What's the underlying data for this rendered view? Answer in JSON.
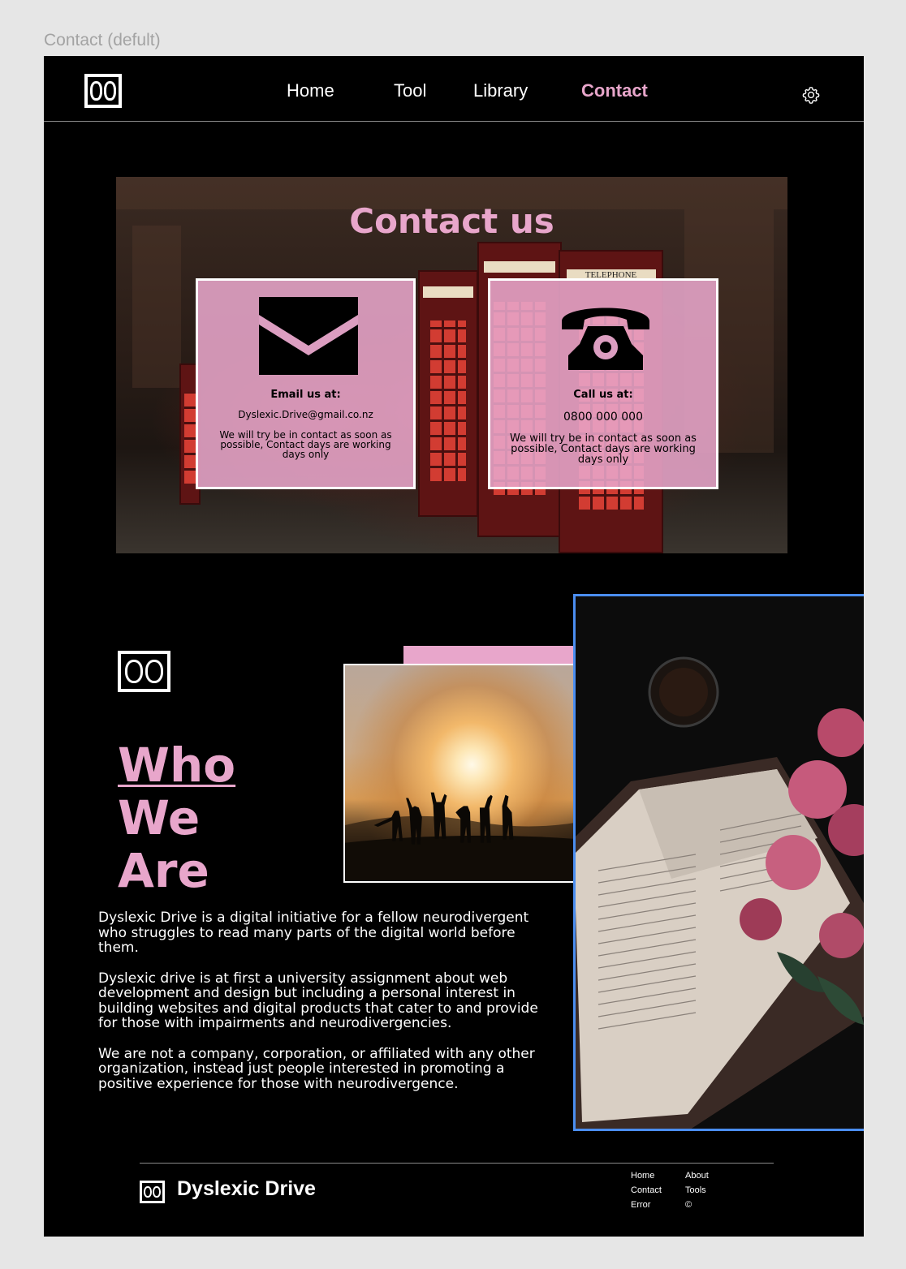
{
  "frame_label": "Contact (defult)",
  "nav": {
    "links": [
      "Home",
      "Tool",
      "Library",
      "Contact"
    ],
    "active": "Contact"
  },
  "hero": {
    "title": "Contact us",
    "email_card": {
      "heading": "Email us at:",
      "value": "Dyslexic.Drive@gmail.co.nz",
      "note": "We will try be in contact as soon as possible, Contact days are working days only",
      "icon": "envelope-icon"
    },
    "call_card": {
      "heading": "Call us at:",
      "value": "0800 000 000",
      "note": "We will try be in contact as soon as possible, Contact days are working days only",
      "icon": "telephone-icon"
    },
    "booth_sign": "TELEPHONE"
  },
  "about": {
    "title": [
      "Who",
      "We",
      "Are"
    ],
    "paragraphs": [
      "Dyslexic Drive is a digital initiative for a fellow neurodivergent who struggles to read many parts of the digital world before them.",
      "Dyslexic drive is at first a university assignment about web development and design but including a personal interest in building websites and digital products that cater to and provide for those with impairments and neurodivergencies.",
      "We are not a company, corporation, or affiliated with any other organization, instead just people interested in promoting a positive experience for those with neurodivergence."
    ]
  },
  "footer": {
    "brand": "Dyslexic Drive",
    "col1": [
      "Home",
      "Contact",
      "Error"
    ],
    "col2": [
      "About",
      "Tools",
      "©"
    ]
  },
  "colors": {
    "accent_pink": "#e8a6cb",
    "background": "#000000",
    "selection_blue": "#4b8ef0"
  }
}
